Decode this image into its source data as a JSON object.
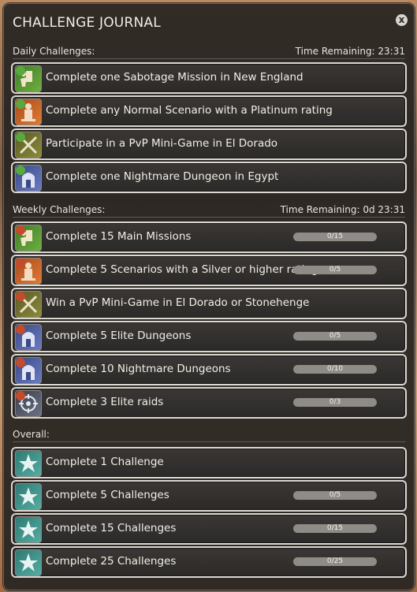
{
  "title": "CHALLENGE JOURNAL",
  "close_label": "x",
  "daily": {
    "label": "Daily Challenges:",
    "time_remaining": "Time Remaining: 23:31",
    "items": [
      {
        "text": "Complete one Sabotage Mission in New England",
        "icon": "sabotage-mission-icon",
        "bg": "green"
      },
      {
        "text": "Complete any Normal Scenario with a Platinum rating",
        "icon": "scenario-icon",
        "bg": "orange"
      },
      {
        "text": "Participate in a PvP Mini-Game in El Dorado",
        "icon": "crossed-swords-icon",
        "bg": "olive"
      },
      {
        "text": "Complete one Nightmare Dungeon in Egypt",
        "icon": "dungeon-icon",
        "bg": "blue"
      }
    ]
  },
  "weekly": {
    "label": "Weekly Challenges:",
    "time_remaining": "Time Remaining: 0d 23:31",
    "items": [
      {
        "text": "Complete 15 Main Missions",
        "progress": "0/15",
        "icon": "sabotage-mission-icon",
        "bg": "green"
      },
      {
        "text": "Complete 5 Scenarios with a Silver or higher rating",
        "progress": "0/5",
        "icon": "scenario-icon",
        "bg": "orange"
      },
      {
        "text": "Win a PvP Mini-Game in El Dorado or Stonehenge",
        "progress": "",
        "icon": "crossed-swords-icon",
        "bg": "olive"
      },
      {
        "text": "Complete 5 Elite Dungeons",
        "progress": "0/5",
        "icon": "dungeon-icon",
        "bg": "blue"
      },
      {
        "text": "Complete 10 Nightmare Dungeons",
        "progress": "0/10",
        "icon": "dungeon-icon",
        "bg": "blue"
      },
      {
        "text": "Complete 3 Elite raids",
        "progress": "0/3",
        "icon": "raid-icon",
        "bg": "gray"
      }
    ]
  },
  "overall": {
    "label": "Overall:",
    "items": [
      {
        "text": "Complete 1 Challenge",
        "progress": "",
        "icon": "star-emblem-icon",
        "bg": "teal"
      },
      {
        "text": "Complete 5 Challenges",
        "progress": "0/5",
        "icon": "star-emblem-icon",
        "bg": "teal"
      },
      {
        "text": "Complete 15 Challenges",
        "progress": "0/15",
        "icon": "star-emblem-icon",
        "bg": "teal"
      },
      {
        "text": "Complete 25 Challenges",
        "progress": "0/25",
        "icon": "star-emblem-icon",
        "bg": "teal"
      }
    ]
  }
}
